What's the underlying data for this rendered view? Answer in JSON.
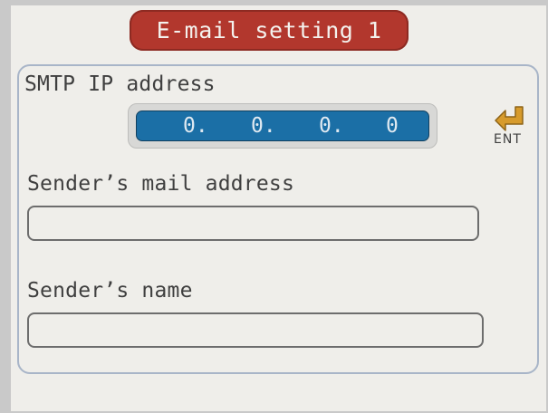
{
  "header": {
    "title": "E-mail setting 1"
  },
  "smtp": {
    "label": "SMTP IP address",
    "octets": [
      "0.",
      "0.",
      "0.",
      "0"
    ]
  },
  "sender_mail": {
    "label": "Sender’s mail address",
    "value": ""
  },
  "sender_name": {
    "label": "Sender’s name",
    "value": ""
  },
  "enter_button": {
    "label": "ENT",
    "icon": "enter-return-arrow-icon",
    "icon_color": "#d79b2c"
  },
  "colors": {
    "title_background": "#b2372d",
    "ip_field_background": "#1b6fa6",
    "screen_background": "#efeeea",
    "panel_border": "#a8b5c8"
  }
}
